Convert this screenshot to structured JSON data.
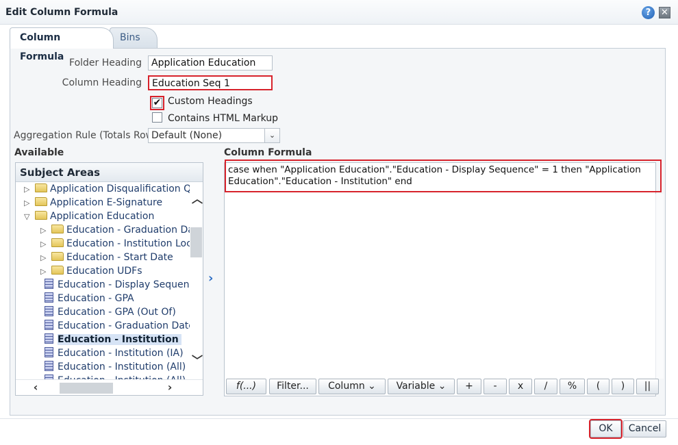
{
  "dialog": {
    "title": "Edit Column Formula",
    "help_icon": "help-icon",
    "close_icon": "close-icon"
  },
  "tabs": [
    {
      "label": "Column Formula"
    },
    {
      "label": "Bins"
    }
  ],
  "form": {
    "folder_heading_label": "Folder Heading",
    "folder_heading_value": "Application Education",
    "column_heading_label": "Column Heading",
    "column_heading_value": "Education Seq 1",
    "custom_headings_label": "Custom Headings",
    "custom_headings_checked": true,
    "html_markup_label": "Contains HTML Markup",
    "html_markup_checked": false,
    "aggregation_label": "Aggregation Rule (Totals Row)",
    "aggregation_value": "Default (None)"
  },
  "available": {
    "title": "Available",
    "header": "Subject Areas",
    "items": [
      {
        "label": "Application Disqualification Ques",
        "type": "folder",
        "expander": "▷"
      },
      {
        "label": "Application E-Signature",
        "type": "folder",
        "expander": "▷"
      },
      {
        "label": "Application Education",
        "type": "folder",
        "expander": "▽"
      },
      {
        "label": "Education - Graduation Date",
        "type": "folder",
        "expander": "▷"
      },
      {
        "label": "Education - Institution Locati",
        "type": "folder",
        "expander": "▷"
      },
      {
        "label": "Education - Start Date",
        "type": "folder",
        "expander": "▷"
      },
      {
        "label": "Education UDFs",
        "type": "folder",
        "expander": "▷"
      },
      {
        "label": "Education - Display Sequenc",
        "type": "column",
        "expander": ""
      },
      {
        "label": "Education - GPA",
        "type": "column",
        "expander": ""
      },
      {
        "label": "Education - GPA (Out Of)",
        "type": "column",
        "expander": ""
      },
      {
        "label": "Education - Graduation Date",
        "type": "column",
        "expander": ""
      },
      {
        "label": "Education - Institution",
        "type": "column",
        "expander": "",
        "selected": true
      },
      {
        "label": "Education - Institution (IA)",
        "type": "column",
        "expander": ""
      },
      {
        "label": "Education - Institution (All)",
        "type": "column",
        "expander": ""
      },
      {
        "label": "Education - Institution (All) (",
        "type": "column",
        "expander": ""
      }
    ]
  },
  "formula": {
    "title": "Column Formula",
    "text": "case when \"Application Education\".\"Education - Display Sequence\" = 1 then \"Application Education\".\"Education - Institution\" end",
    "toolbar": [
      "f(...)",
      "Filter...",
      "Column ⌄",
      "Variable ⌄",
      "+",
      "-",
      "x",
      "/",
      "%",
      "(",
      ")",
      "||"
    ]
  },
  "footer": {
    "ok_label": "OK",
    "cancel_label": "Cancel"
  }
}
